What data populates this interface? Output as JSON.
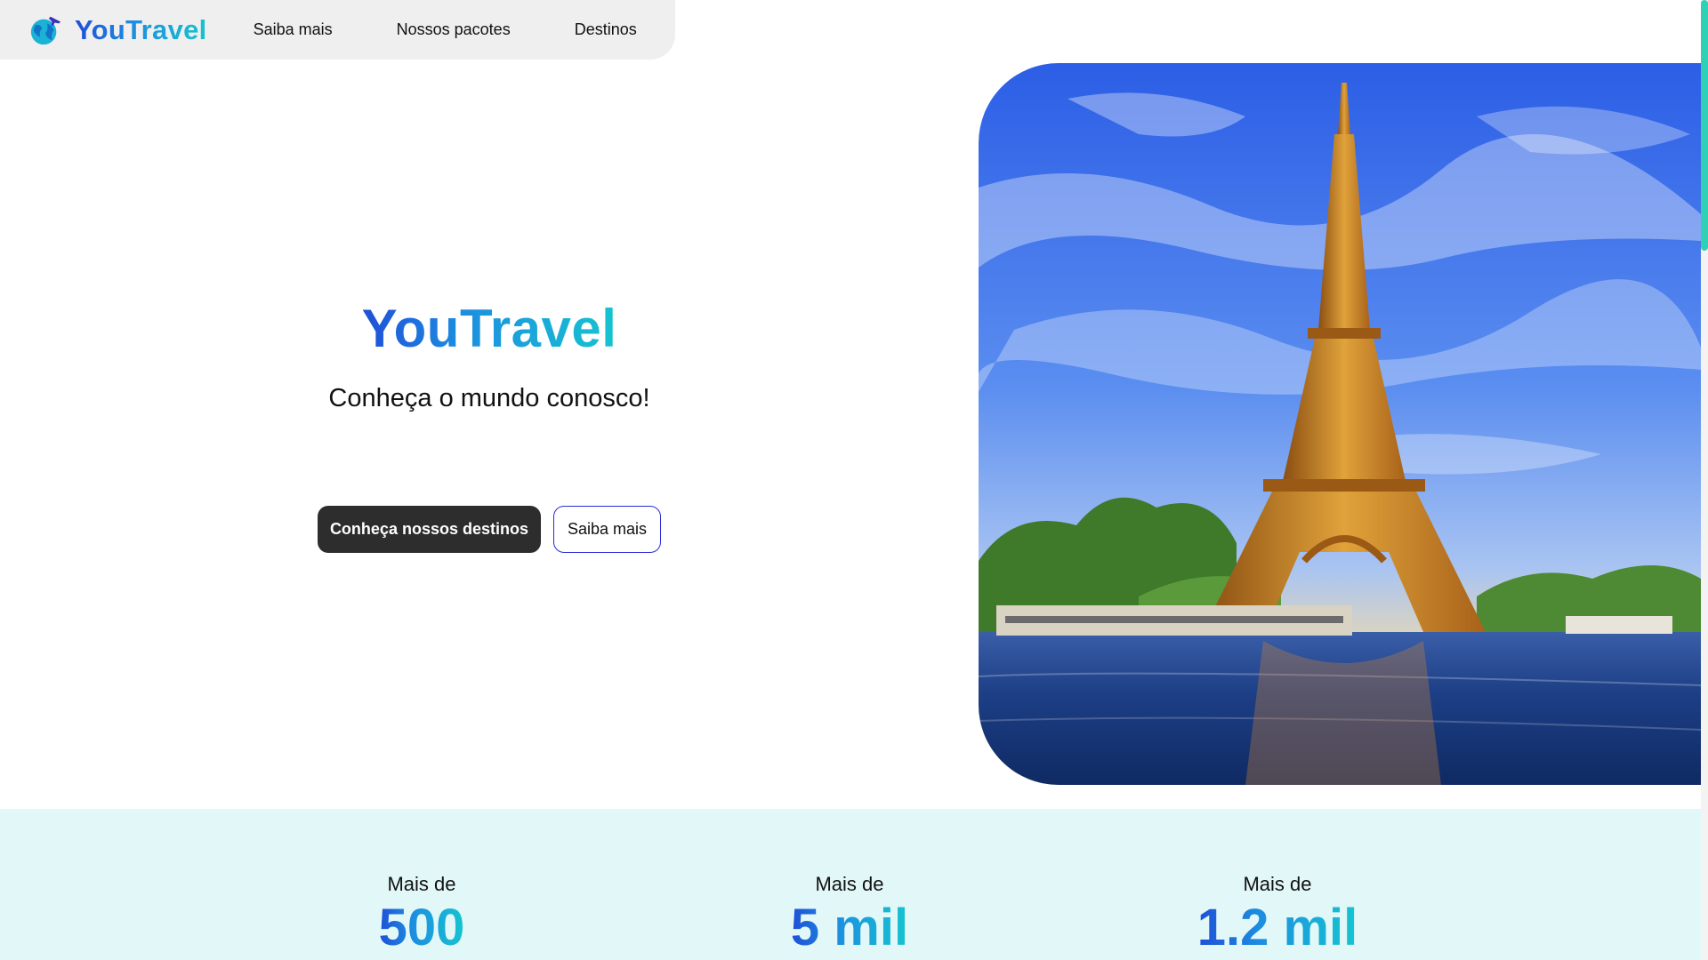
{
  "nav": {
    "brand": "YouTravel",
    "links": [
      "Saiba mais",
      "Nossos pacotes",
      "Destinos"
    ]
  },
  "hero": {
    "title": "YouTravel",
    "subtitle": "Conheça o mundo conosco!",
    "primary_button": "Conheça nossos destinos",
    "secondary_button": "Saiba mais"
  },
  "stats": [
    {
      "prefix": "Mais de",
      "value": "500"
    },
    {
      "prefix": "Mais de",
      "value": "5 mil"
    },
    {
      "prefix": "Mais de",
      "value": "1.2 mil"
    }
  ],
  "colors": {
    "brand_blue": "#1f4fd8",
    "brand_cyan": "#16c4d0",
    "nav_background": "#efefef",
    "stats_background": "#e2f8f8",
    "primary_button": "#2d2d2d",
    "outline_border": "#2a2ad8",
    "scrollbar_thumb": "#2fd0b5"
  },
  "icons": {
    "brand": "globe-airplane-icon"
  },
  "image": "eiffel-tower-photo"
}
